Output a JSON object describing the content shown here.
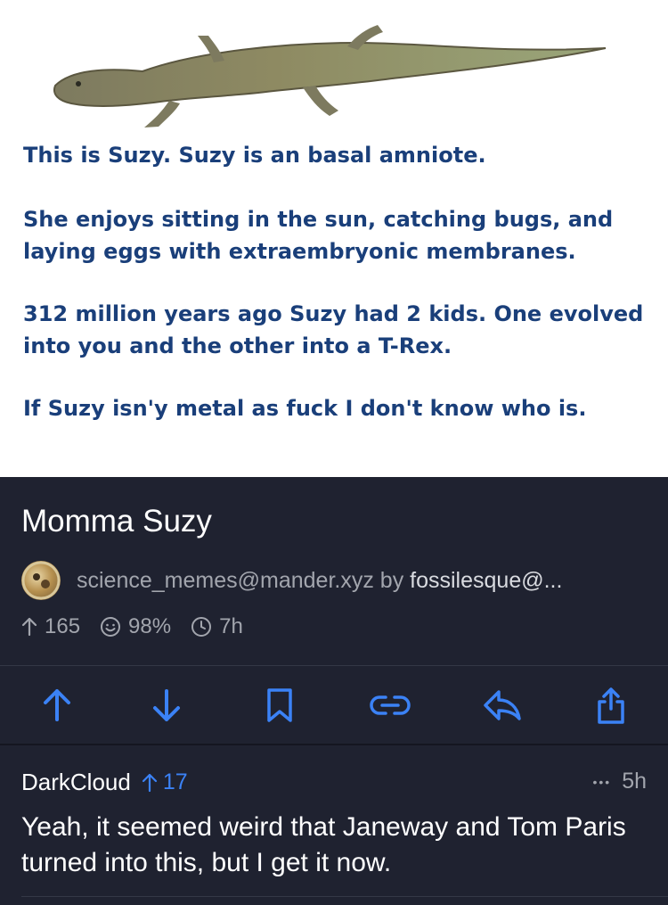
{
  "meme": {
    "image": "lizard-illustration",
    "line1": "This is Suzy. Suzy is an basal amniote.",
    "line2": "She enjoys sitting in the sun, catching bugs, and laying eggs with extraembryonic membranes.",
    "line3": "312 million years ago Suzy had 2 kids. One evolved into you and the other into a T-Rex.",
    "line4": "If Suzy isn'y metal as fuck I don't know who is."
  },
  "post": {
    "title": "Momma Suzy",
    "community": "science_memes@mander.xyz",
    "by_label": "by",
    "author": "fossilesque@...",
    "score": "165",
    "upvote_ratio": "98%",
    "age": "7h"
  },
  "actions": [
    {
      "icon": "upvote-arrow-icon"
    },
    {
      "icon": "downvote-arrow-icon"
    },
    {
      "icon": "bookmark-icon"
    },
    {
      "icon": "link-icon"
    },
    {
      "icon": "reply-icon"
    },
    {
      "icon": "share-icon"
    }
  ],
  "comment": {
    "user": "DarkCloud",
    "score": "17",
    "age": "5h",
    "more": "•••",
    "body": "Yeah, it seemed weird that Janeway and Tom Paris turned into this, but I get it now."
  },
  "colors": {
    "accent": "#3b82f6",
    "background": "#1f2230",
    "meme_text": "#1a3f7a"
  }
}
